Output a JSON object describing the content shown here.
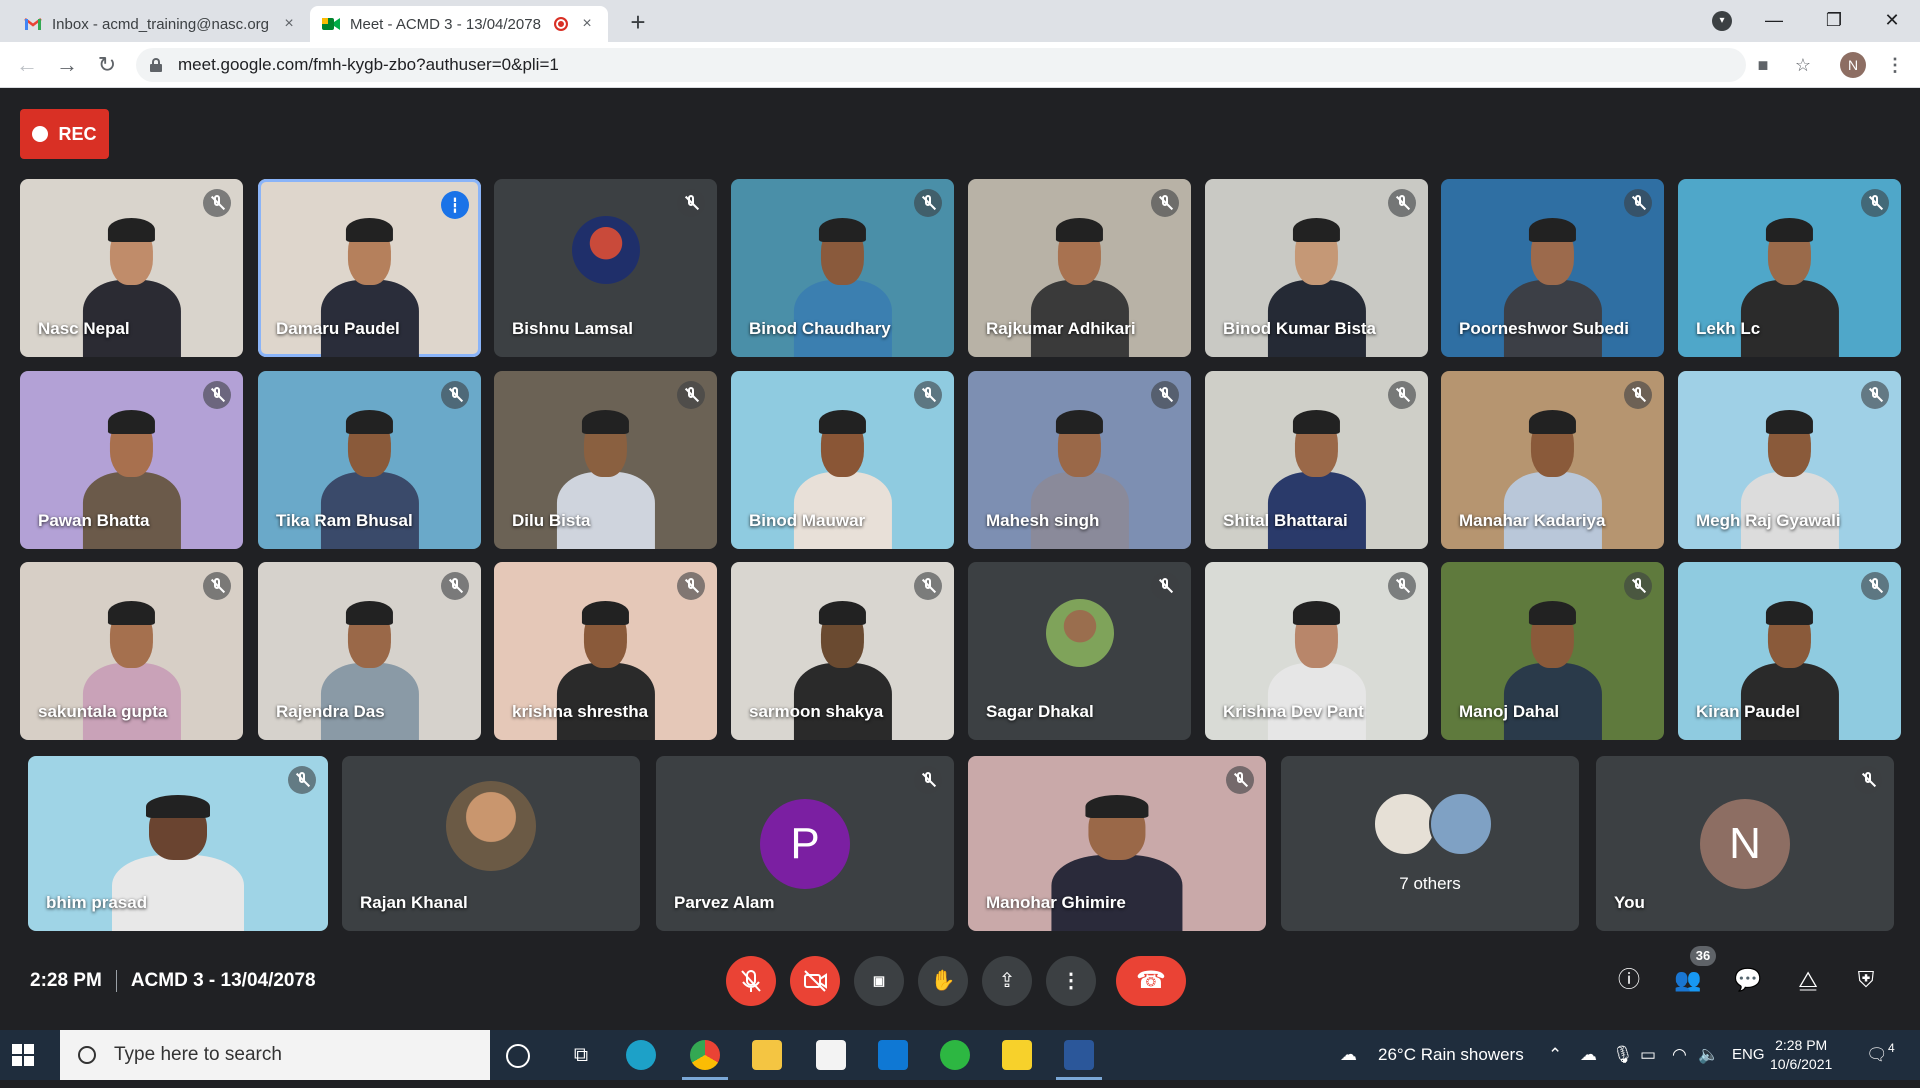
{
  "browser": {
    "tabs": [
      {
        "title": "Inbox - acmd_training@nasc.org",
        "close": "×"
      },
      {
        "title": "Meet - ACMD 3 - 13/04/2078",
        "close": "×"
      }
    ],
    "new_tab": "+",
    "url": "meet.google.com/fmh-kygb-zbo?authuser=0&pli=1",
    "profile_initial": "N"
  },
  "rec_label": "REC",
  "participants": [
    {
      "name": "Nasc Nepal",
      "bg": "#d9d4cc",
      "skin": "#c08c6a",
      "shirt": "#2b2b33"
    },
    {
      "name": "Damaru Paudel",
      "bg": "#ded6cc",
      "skin": "#b5805c",
      "shirt": "#2a2d3a"
    },
    {
      "name": "Bishnu Lamsal"
    },
    {
      "name": "Binod Chaudhary",
      "bg": "#4a8fa8",
      "skin": "#8a5a3c",
      "shirt": "#3b7fb0"
    },
    {
      "name": "Rajkumar Adhikari",
      "bg": "#b8b2a6",
      "skin": "#a87250",
      "shirt": "#3a3a3a"
    },
    {
      "name": "Binod Kumar Bista",
      "bg": "#c9c9c4",
      "skin": "#c59876",
      "shirt": "#252a35"
    },
    {
      "name": "Poorneshwor Subedi",
      "bg": "#2f6fa3",
      "skin": "#9c6a4c",
      "shirt": "#3c3f46"
    },
    {
      "name": "Lekh Lc",
      "bg": "#4fa7c9",
      "skin": "#9a6a4a",
      "shirt": "#2b2b2b"
    },
    {
      "name": "Pawan Bhatta",
      "bg": "#b3a1d6",
      "skin": "#a8704e",
      "shirt": "#6b5a4a"
    },
    {
      "name": "Tika Ram Bhusal",
      "bg": "#6aa9c9",
      "skin": "#8a5a3a",
      "shirt": "#3a4a6a"
    },
    {
      "name": "Dilu Bista",
      "bg": "#6b6255",
      "skin": "#8a6040",
      "shirt": "#cfd4dd"
    },
    {
      "name": "Binod Mauwar",
      "bg": "#8fcbe0",
      "skin": "#8a5636",
      "shirt": "#e8e0d8"
    },
    {
      "name": "Mahesh singh",
      "bg": "#7d8fb2",
      "skin": "#9a6848",
      "shirt": "#8a8a9a"
    },
    {
      "name": "Shital Bhattarai",
      "bg": "#cfcfc8",
      "skin": "#9a6848",
      "shirt": "#2a3a6a"
    },
    {
      "name": "Manahar Kadariya",
      "bg": "#b69570",
      "skin": "#8a5a3a",
      "shirt": "#b9c7d9"
    },
    {
      "name": "Megh Raj Gyawali",
      "bg": "#9fd0e6",
      "skin": "#8a5a3a",
      "shirt": "#dcdcdc"
    },
    {
      "name": "sakuntala gupta",
      "bg": "#d7cfc6",
      "skin": "#a5704e",
      "shirt": "#c9a2b8"
    },
    {
      "name": "Rajendra Das",
      "bg": "#d6d2cc",
      "skin": "#9a6848",
      "shirt": "#8a9aa6"
    },
    {
      "name": "krishna shrestha",
      "bg": "#e5c8b8",
      "skin": "#8a5a3a",
      "shirt": "#2a2a2a"
    },
    {
      "name": "sarmoon shakya",
      "bg": "#d9d6d0",
      "skin": "#6a4a30",
      "shirt": "#2a2a2a"
    },
    {
      "name": "Sagar Dhakal"
    },
    {
      "name": "Krishna Dev Pant",
      "bg": "#d9dbd6",
      "skin": "#b8866a",
      "shirt": "#e6e6e6"
    },
    {
      "name": "Manoj Dahal",
      "bg": "#5f7a3d",
      "skin": "#8a5a3a",
      "shirt": "#2a3a4a"
    },
    {
      "name": "Kiran Paudel",
      "bg": "#8fcbe0",
      "skin": "#8a5a3a",
      "shirt": "#2a2a2a"
    },
    {
      "name": "bhim prasad",
      "bg": "#9fd4e6",
      "skin": "#6a4430",
      "shirt": "#e8e8e8"
    },
    {
      "name": "Rajan Khanal"
    },
    {
      "name": "Parvez Alam",
      "initial": "P",
      "color": "#7b1fa2"
    },
    {
      "name": "Manohar Ghimire",
      "bg": "#c9a9a9",
      "skin": "#9a6848",
      "shirt": "#2a2a3a"
    },
    {
      "name": "7 others"
    },
    {
      "name": "You",
      "initial": "N",
      "color": "#8d6e63"
    }
  ],
  "meeting": {
    "time": "2:28 PM",
    "title": "ACMD 3 - 13/04/2078",
    "participant_count": "36"
  },
  "taskbar": {
    "search_placeholder": "Type here to search",
    "weather": "26°C  Rain showers",
    "lang": "ENG",
    "time": "2:28 PM",
    "date": "10/6/2021",
    "notifications": "4"
  }
}
